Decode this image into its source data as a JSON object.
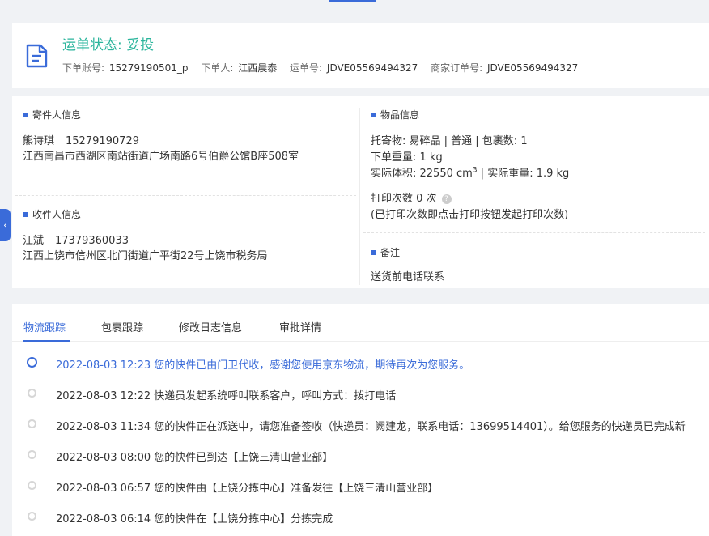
{
  "header": {
    "status": "运单状态: 妥投",
    "order_account_label": "下单账号:",
    "order_account": "15279190501_p",
    "orderer_label": "下单人:",
    "orderer": "江西晨泰",
    "waybill_label": "运单号:",
    "waybill": "JDVE05569494327",
    "merchant_order_label": "商家订单号:",
    "merchant_order": "JDVE05569494327"
  },
  "sender": {
    "title": "寄件人信息",
    "name": "熊诗琪",
    "phone": "15279190729",
    "address": "江西南昌市西湖区南站街道广场南路6号伯爵公馆B座508室"
  },
  "receiver": {
    "title": "收件人信息",
    "name": "江斌",
    "phone": "17379360033",
    "address": "江西上饶市信州区北门街道广平街22号上饶市税务局"
  },
  "goods": {
    "title": "物品信息",
    "line1": "托寄物:  易碎品 | 普通  |  包裹数:  1",
    "line2": "下单重量:  1 kg",
    "line3_a": "实际体积:   22550 cm",
    "line3_sup": "3",
    "line3_b": " |  实际重量:   1.9 kg",
    "print_count": "打印次数    0 次",
    "print_note": "(已打印次数即点击打印按钮发起打印次数)"
  },
  "remark": {
    "title": "备注",
    "text": "送货前电话联系"
  },
  "tabs": [
    "物流跟踪",
    "包裹跟踪",
    "修改日志信息",
    "审批详情"
  ],
  "timeline": [
    {
      "text": "2022-08-03 12:23 您的快件已由门卫代收，感谢您使用京东物流，期待再次为您服务。",
      "active": true
    },
    {
      "text": "2022-08-03 12:22 快递员发起系统呼叫联系客户，呼叫方式：拨打电话",
      "active": false
    },
    {
      "text": "2022-08-03 11:34 您的快件正在派送中，请您准备签收（快递员：阙建龙，联系电话：13699514401）。给您服务的快递员已完成新",
      "active": false
    },
    {
      "text": "2022-08-03 08:00 您的快件已到达【上饶三清山营业部】",
      "active": false
    },
    {
      "text": "2022-08-03 06:57 您的快件由【上饶分拣中心】准备发往【上饶三清山营业部】",
      "active": false
    },
    {
      "text": "2022-08-03 06:14 您的快件在【上饶分拣中心】分拣完成",
      "active": false
    }
  ],
  "side_tab_icon": "chevron-left-icon",
  "colors": {
    "accent": "#3a6bd9",
    "status": "#2bb59c"
  }
}
